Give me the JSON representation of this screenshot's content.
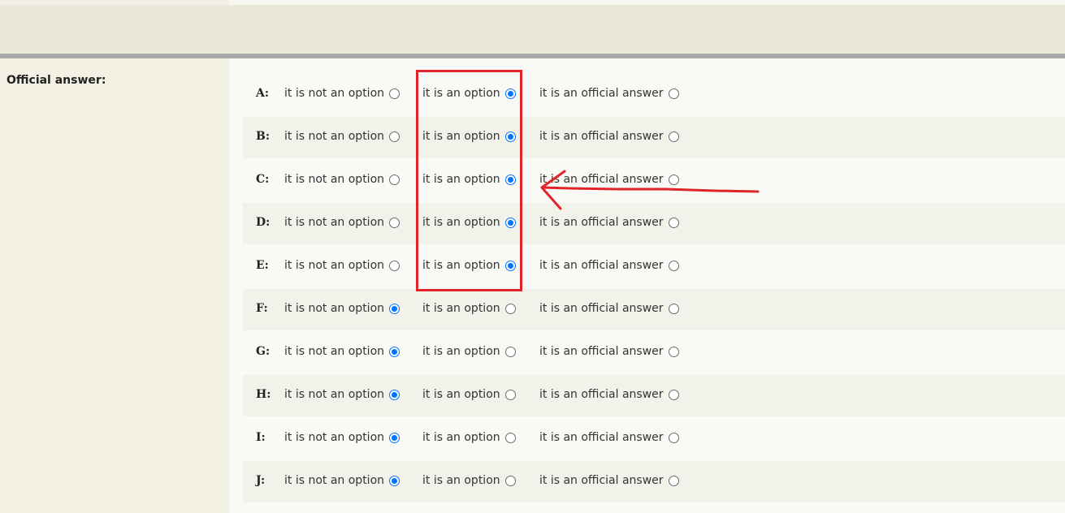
{
  "section_label": "Official answer:",
  "choice_labels": {
    "not_option": "it is not an option",
    "option": "it is an option",
    "official": "it is an official answer"
  },
  "rows": [
    {
      "letter": "A:",
      "not_option": "it is not an option",
      "option": "it is an option",
      "official": "it is an official answer",
      "selected": "option"
    },
    {
      "letter": "B:",
      "not_option": "it is not an option",
      "option": "it is an option",
      "official": "it is an official answer",
      "selected": "option"
    },
    {
      "letter": "C:",
      "not_option": "it is not an option",
      "option": "it is an option",
      "official": "it is an official answer",
      "selected": "option"
    },
    {
      "letter": "D:",
      "not_option": "it is not an option",
      "option": "it is an option",
      "official": "it is an official answer",
      "selected": "option"
    },
    {
      "letter": "E:",
      "not_option": "it is not an option",
      "option": "it is an option",
      "official": "it is an official answer",
      "selected": "option"
    },
    {
      "letter": "F:",
      "not_option": "it is not an option",
      "option": "it is an option",
      "official": "it is an official answer",
      "selected": "not_option"
    },
    {
      "letter": "G:",
      "not_option": "it is not an option",
      "option": "it is an option",
      "official": "it is an official answer",
      "selected": "not_option"
    },
    {
      "letter": "H:",
      "not_option": "it is not an option",
      "option": "it is an option",
      "official": "it is an official answer",
      "selected": "not_option"
    },
    {
      "letter": "I:",
      "not_option": "it is not an option",
      "option": "it is an option",
      "official": "it is an official answer",
      "selected": "not_option"
    },
    {
      "letter": "J:",
      "not_option": "it is not an option",
      "option": "it is an option",
      "official": "it is an official answer",
      "selected": "not_option"
    }
  ],
  "colors": {
    "accent_radio": "#0075ff",
    "annotation_red": "#e0242a",
    "band": "#eae8d8",
    "separator": "#a9a9a9"
  },
  "annotation": {
    "box_icon": "highlight-rectangle",
    "arrow_icon": "left-arrow-annotation"
  }
}
